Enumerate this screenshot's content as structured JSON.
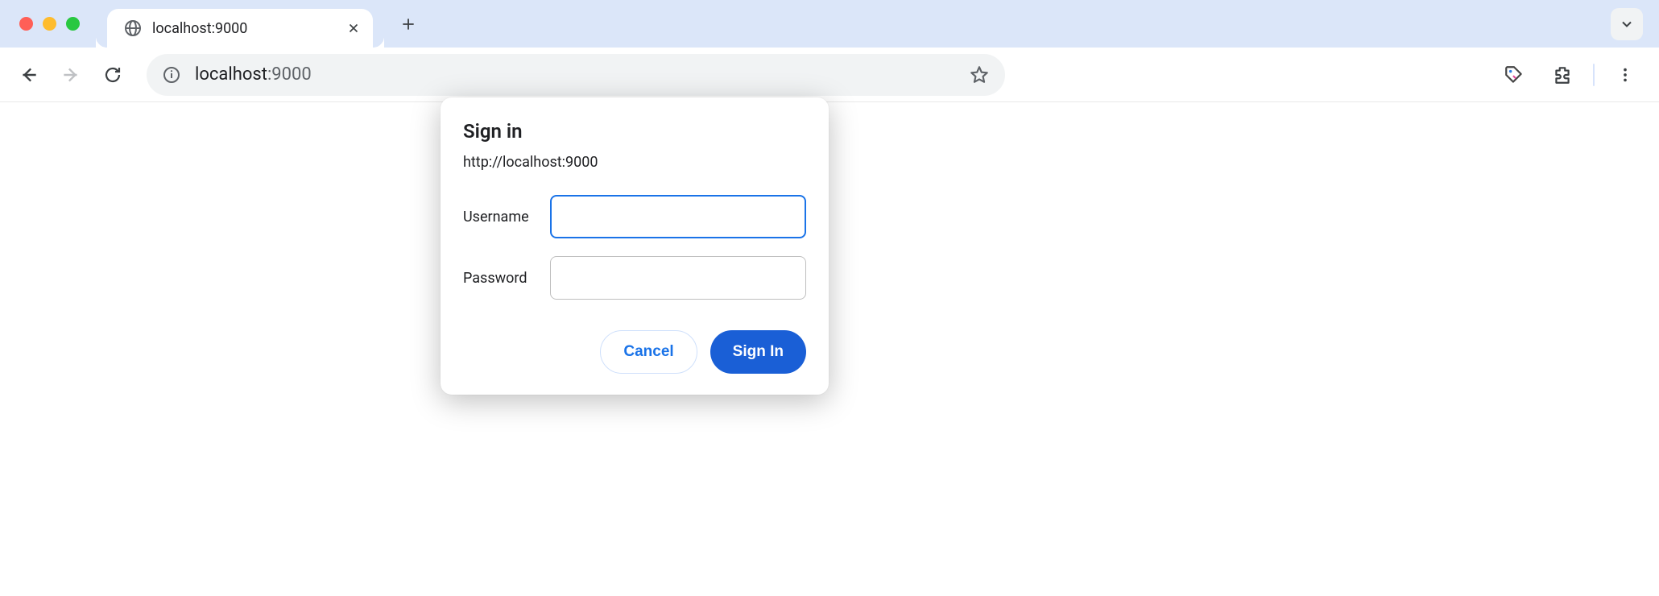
{
  "tab": {
    "title": "localhost:9000"
  },
  "omnibox": {
    "host": "localhost",
    "port": ":9000"
  },
  "auth_dialog": {
    "title": "Sign in",
    "origin": "http://localhost:9000",
    "username_label": "Username",
    "username_value": "",
    "password_label": "Password",
    "password_value": "",
    "cancel_label": "Cancel",
    "signin_label": "Sign In"
  }
}
